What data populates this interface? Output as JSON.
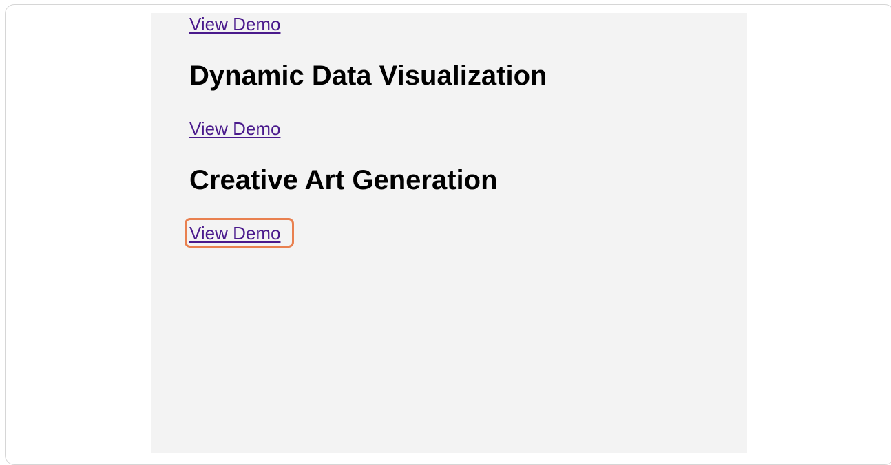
{
  "projects": [
    {
      "link_label": "View Demo"
    },
    {
      "title": "Dynamic Data Visualization",
      "link_label": "View Demo"
    },
    {
      "title": "Creative Art Generation",
      "link_label": "View Demo"
    }
  ],
  "colors": {
    "link": "#4a1a8c",
    "panel_background": "#f3f3f3",
    "highlight": "#e9804f"
  }
}
